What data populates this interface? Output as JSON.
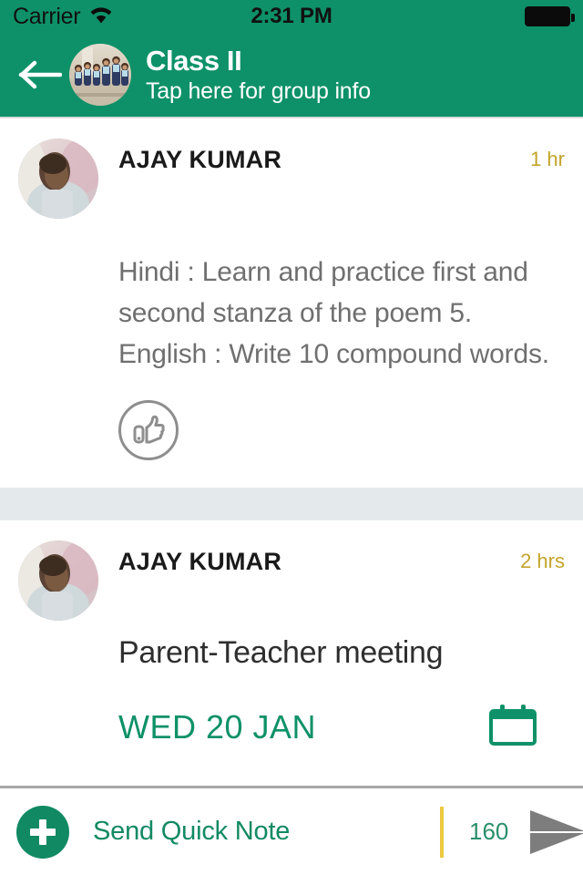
{
  "status_bar": {
    "carrier": "Carrier",
    "wifi_icon": "wifi-icon",
    "time": "2:31 PM",
    "battery_icon": "battery-full-icon"
  },
  "header": {
    "back_icon": "back-arrow-icon",
    "group_avatar": "group-photo-avatar",
    "title": "Class II",
    "subtitle": "Tap here for group info",
    "background_color": "#0e9168"
  },
  "feed": {
    "posts": [
      {
        "author": "AJAY KUMAR",
        "timestamp": "1 hr",
        "avatar": "teacher-avatar",
        "body": "Hindi : Learn and practice first and second stanza of the poem 5. English : Write 10 compound words.",
        "like_icon": "thumbs-up-icon"
      },
      {
        "author": "AJAY KUMAR",
        "timestamp": "2 hrs",
        "avatar": "teacher-avatar",
        "headline": "Parent-Teacher meeting",
        "event_date": "WED 20 JAN",
        "calendar_icon": "calendar-icon"
      }
    ]
  },
  "composer": {
    "add_icon": "plus-icon",
    "placeholder": "Send Quick Note",
    "value": "",
    "char_counter": "160",
    "send_icon": "send-arrow-icon"
  },
  "colors": {
    "brand_green": "#0e9168",
    "accent_yellow": "#ecc93f",
    "timestamp_gold": "#c4a42a",
    "body_gray": "#6f6f6f",
    "separator": "#e4eaec"
  }
}
